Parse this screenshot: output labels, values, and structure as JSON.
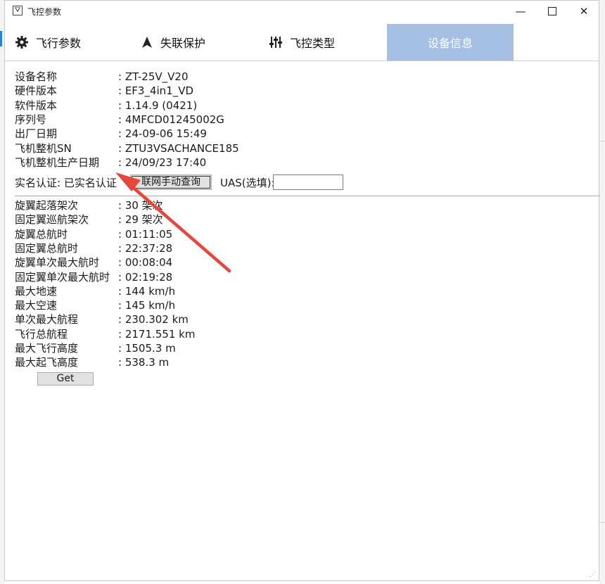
{
  "window": {
    "title": "飞控参数",
    "app_icon": "drone-logo-icon"
  },
  "tabs": [
    {
      "label": "飞行参数",
      "icon": "gear-icon"
    },
    {
      "label": "失联保护",
      "icon": "arrow-up-icon"
    },
    {
      "label": "飞控类型",
      "icon": "sliders-icon"
    },
    {
      "label": "设备信息",
      "icon": ""
    }
  ],
  "active_tab": "设备信息",
  "device": [
    {
      "label": "设备名称",
      "value": ": ZT-25V_V20"
    },
    {
      "label": "硬件版本",
      "value": ": EF3_4in1_VD"
    },
    {
      "label": "软件版本",
      "value": ": 1.14.9 (0421)"
    },
    {
      "label": "序列号",
      "value": ": 4MFCD01245002G"
    },
    {
      "label": "出厂日期",
      "value": ": 24-09-06 15:49"
    },
    {
      "label": "飞机整机SN",
      "value": ": ZTU3VSACHANCE185"
    },
    {
      "label": "飞机整机生产日期",
      "value": ": 24/09/23 17:40"
    }
  ],
  "auth": {
    "text": "实名认证: 已实名认证",
    "query_button": "联网手动查询",
    "uas_label": "UAS(选填):",
    "uas_value": ""
  },
  "stats": [
    {
      "label": "旋翼起落架次",
      "value": ": 30 架次"
    },
    {
      "label": "固定翼巡航架次",
      "value": ": 29 架次"
    },
    {
      "label": "旋翼总航时",
      "value": ": 01:11:05"
    },
    {
      "label": "固定翼总航时",
      "value": ": 22:37:28"
    },
    {
      "label": "旋翼单次最大航时",
      "value": ": 00:08:04"
    },
    {
      "label": "固定翼单次最大航时",
      "value": ": 02:19:28"
    },
    {
      "label": "最大地速",
      "value": ": 144 km/h"
    },
    {
      "label": "最大空速",
      "value": ": 145 km/h"
    },
    {
      "label": "单次最大航程",
      "value": ": 230.302 km"
    },
    {
      "label": "飞行总航程",
      "value": ": 2171.551 km"
    },
    {
      "label": "最大飞行高度",
      "value": ": 1505.3 m"
    },
    {
      "label": "最大起飞高度",
      "value": ": 538.3 m"
    }
  ],
  "get_button": "Get",
  "colors": {
    "active_tab_bg": "#a5c0e3",
    "annotation_arrow": "#e8463b"
  }
}
